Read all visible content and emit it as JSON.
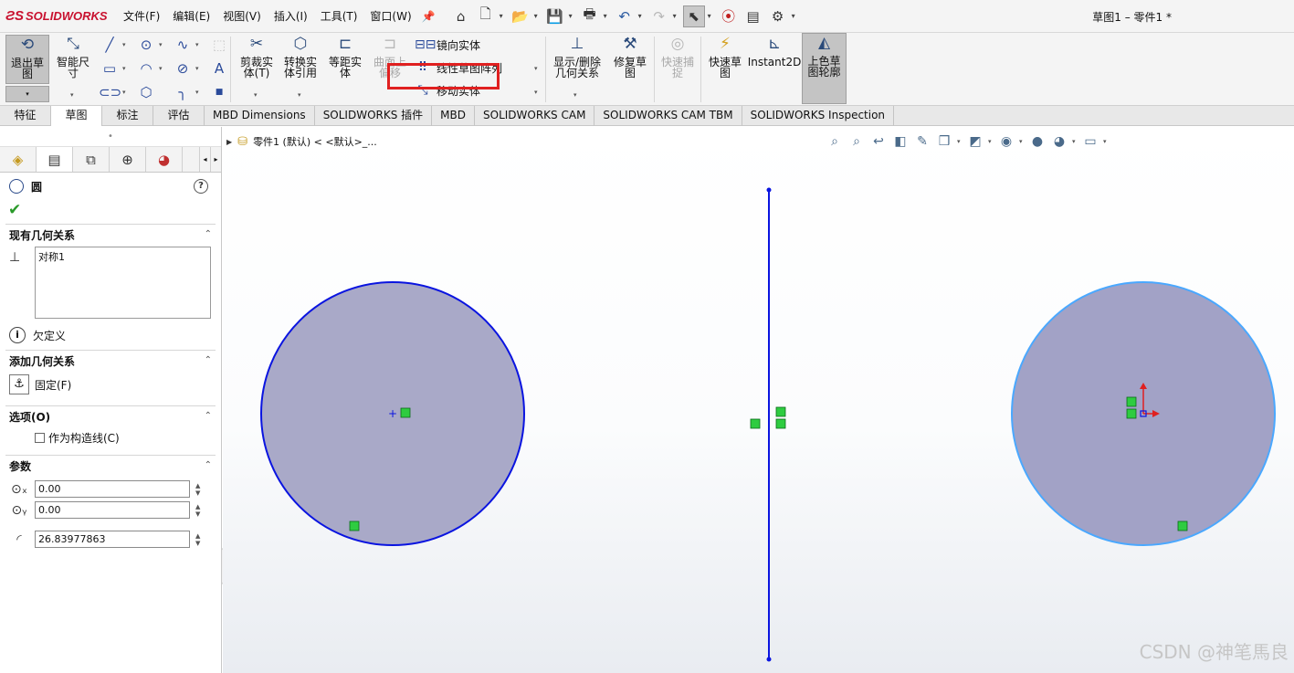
{
  "app": {
    "brand": "SOLIDWORKS",
    "window_title": "草图1 – 零件1 *"
  },
  "menu": [
    "文件(F)",
    "编辑(E)",
    "视图(V)",
    "插入(I)",
    "工具(T)",
    "窗口(W)"
  ],
  "quick_access": [
    "home-icon",
    "new-icon",
    "open-icon",
    "save-icon",
    "print-icon",
    "undo-icon",
    "redo-icon",
    "select-icon",
    "traffic-light-icon",
    "file-properties-icon",
    "options-icon"
  ],
  "ribbon": {
    "exit_sketch": "退出草\n图",
    "smart_dimension": "智能尺\n寸",
    "trim_entities": "剪裁实\n体(T)",
    "convert_entities": "转换实\n体引用",
    "offset_entities": "等距实\n体",
    "offset_surface": "曲面上\n偏移",
    "mirror_entities": "镜向实体",
    "linear_pattern": "线性草图阵列",
    "move_entities": "移动实体",
    "display_relations": "显示/删除\n几何关系",
    "repair_sketch": "修复草\n图",
    "quick_snaps": "快速捕\n捉",
    "rapid_sketch": "快速草\n图",
    "instant2d": "Instant2D",
    "shaded_contours": "上色草\n图轮廓"
  },
  "tabs": [
    {
      "label": "特征",
      "active": false
    },
    {
      "label": "草图",
      "active": true
    },
    {
      "label": "标注",
      "active": false
    },
    {
      "label": "评估",
      "active": false
    },
    {
      "label": "MBD Dimensions",
      "active": false
    },
    {
      "label": "SOLIDWORKS 插件",
      "active": false
    },
    {
      "label": "MBD",
      "active": false
    },
    {
      "label": "SOLIDWORKS CAM",
      "active": false
    },
    {
      "label": "SOLIDWORKS CAM TBM",
      "active": false
    },
    {
      "label": "SOLIDWORKS Inspection",
      "active": false
    }
  ],
  "property_manager": {
    "title": "圆",
    "existing_relations_title": "现有几何关系",
    "relations": [
      "对称1"
    ],
    "status": "欠定义",
    "add_relations_title": "添加几何关系",
    "fix_label": "固定(F)",
    "options_title": "选项(O)",
    "construction_label": "作为构造线(C)",
    "params_title": "参数",
    "center_x": "0.00",
    "center_y": "0.00",
    "radius": "26.83977863"
  },
  "graphics": {
    "tree_path": "零件1 (默认) < <默认>_..."
  },
  "watermark": "CSDN @神笔馬良",
  "colors": {
    "accent_highlight": "#e02020",
    "selected_circle": "#0a14e0",
    "mirrored_circle": "#4aa8ff",
    "circle_fill": "#a9a9c8",
    "relation_marker": "#2ecc40"
  }
}
